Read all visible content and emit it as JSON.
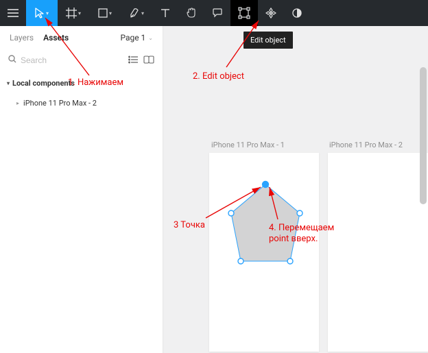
{
  "toolbar": {
    "tooltip": "Edit object"
  },
  "sidebar": {
    "tabs": {
      "layers": "Layers",
      "assets": "Assets"
    },
    "page_label": "Page 1",
    "search_placeholder": "Search",
    "section_header": "Local components",
    "items": [
      "iPhone 11 Pro Max - 2"
    ]
  },
  "canvas": {
    "artboards": [
      {
        "label": "iPhone 11 Pro Max - 1"
      },
      {
        "label": "iPhone 11 Pro Max - 2"
      }
    ]
  },
  "annotations": {
    "a1": "1. Нажимаем",
    "a2": "2. Edit object",
    "a3": "3 Точка",
    "a4_line1": "4. Перемещаем",
    "a4_line2": "point вверх."
  }
}
